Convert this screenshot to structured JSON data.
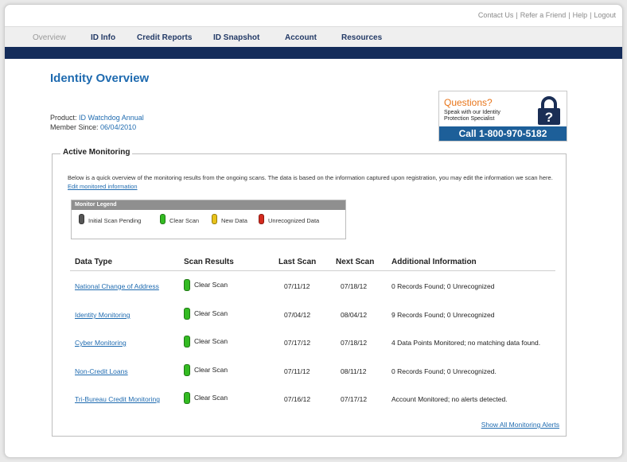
{
  "top_links": [
    "Contact Us",
    "Refer a Friend",
    "Help",
    "Logout"
  ],
  "nav": {
    "items": [
      "Overview",
      "ID Info",
      "Credit Reports",
      "ID Snapshot",
      "Account",
      "Resources"
    ],
    "active": "Overview"
  },
  "page_title": "Identity Overview",
  "product": {
    "product_label": "Product:",
    "product_value": "ID Watchdog Annual",
    "member_label": "Member Since:",
    "member_value": "06/04/2010"
  },
  "questions": {
    "title": "Questions?",
    "subtitle": "Speak with our Identity Protection Specialist",
    "call": "Call 1-800-970-5182",
    "icon": "lock-question-icon"
  },
  "monitoring": {
    "section_title": "Active Monitoring",
    "intro_text": "Below is a quick overview of the monitoring results from the ongoing scans. The data is based on the information captured upon registration, you may edit the information we scan here.",
    "edit_link": "Edit monitored information",
    "legend": {
      "title": "Monitor Legend",
      "items": [
        {
          "label": "Initial Scan Pending",
          "color": "#555555"
        },
        {
          "label": "Clear Scan",
          "color": "#33bb22"
        },
        {
          "label": "New Data",
          "color": "#e8c21a"
        },
        {
          "label": "Unrecognized Data",
          "color": "#d42a1e"
        }
      ]
    },
    "columns": [
      "Data Type",
      "Scan Results",
      "Last Scan",
      "Next Scan",
      "Additional Information"
    ],
    "rows": [
      {
        "type": "National Change of Address",
        "result": "Clear Scan",
        "last": "07/11/12",
        "next": "07/18/12",
        "info": "0 Records Found; 0 Unrecognized"
      },
      {
        "type": "Identity Monitoring",
        "result": "Clear Scan",
        "last": "07/04/12",
        "next": "08/04/12",
        "info": "9 Records Found; 0 Unrecognized"
      },
      {
        "type": "Cyber Monitoring",
        "result": "Clear Scan",
        "last": "07/17/12",
        "next": "07/18/12",
        "info": "4 Data Points Monitored; no matching data found."
      },
      {
        "type": "Non-Credit Loans",
        "result": "Clear Scan",
        "last": "07/11/12",
        "next": "08/11/12",
        "info": "0 Records Found; 0 Unrecognized."
      },
      {
        "type": "Tri-Bureau Credit Monitoring",
        "result": "Clear Scan",
        "last": "07/16/12",
        "next": "07/17/12",
        "info": "Account Monitored; no alerts detected."
      }
    ],
    "show_all": "Show All Monitoring Alerts"
  },
  "colors": {
    "navbar": "#142c5a",
    "link": "#1f6bb0",
    "accent": "#e8751a",
    "call_bg": "#1d5f99"
  }
}
